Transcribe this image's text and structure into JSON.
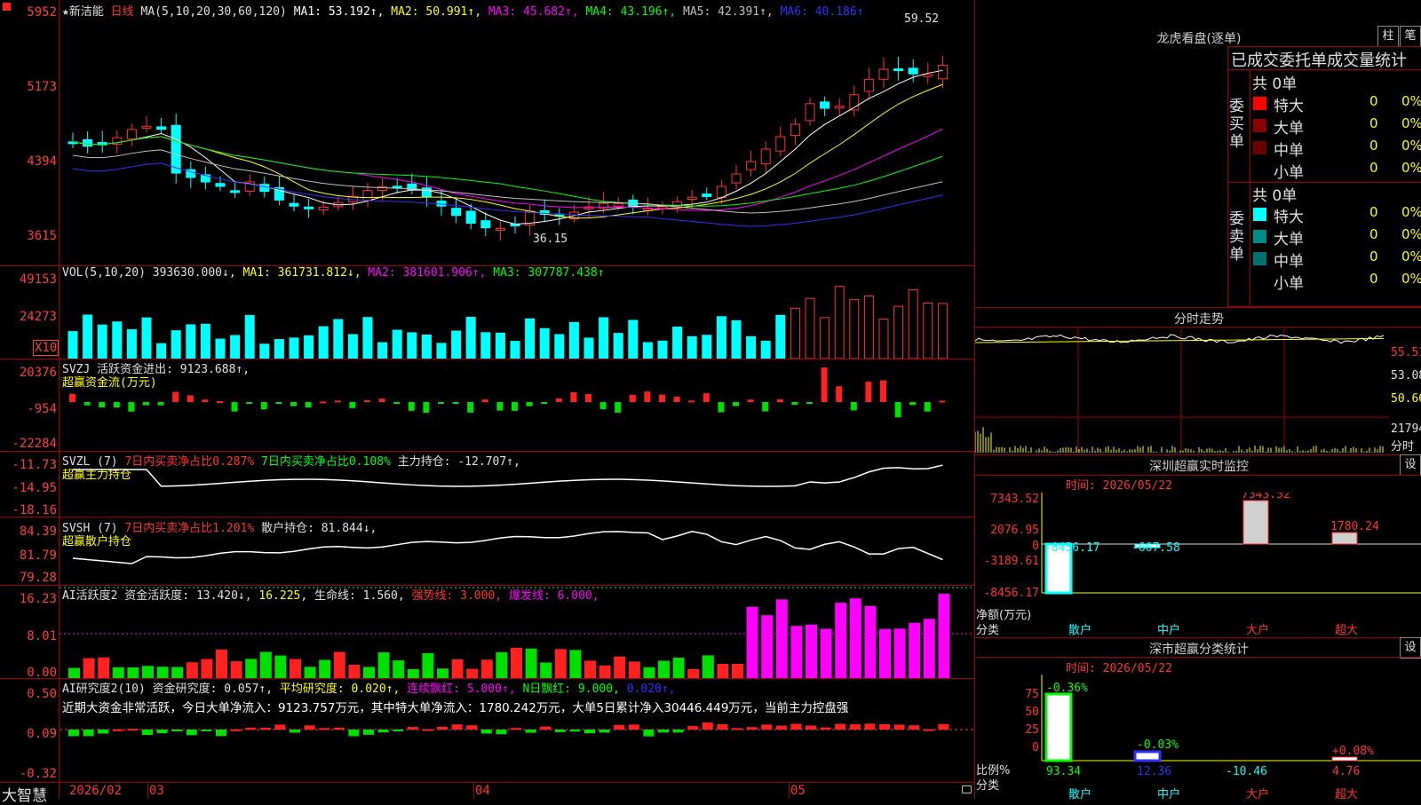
{
  "app": {
    "name": "大智慧"
  },
  "kline": {
    "title": "★新洁能",
    "period": "日线",
    "ma_label": "MA(5,10,20,30,60,120)",
    "ma1": "MA1: 53.192↑,",
    "ma2": "MA2: 50.991↑,",
    "ma3": "MA3: 45.682↑,",
    "ma4": "MA4: 43.196↑,",
    "ma5": "MA5: 42.391↑,",
    "ma6": "MA6: 40.186↑",
    "y_labels": [
      "5952",
      "5173",
      "4394",
      "3615"
    ],
    "high_label": "59.52",
    "low_label": "36.15"
  },
  "vol": {
    "title": "VOL(5,10,20) 393630.000↓,",
    "ma1": "MA1: 361731.812↓,",
    "ma2": "MA2: 381601.906↑,",
    "ma3": "MA3: 307787.438↑",
    "y_labels": [
      "49153",
      "24273"
    ],
    "unit": "X10"
  },
  "svzj": {
    "title": "SVZJ  活跃资金进出: 9123.688↑,",
    "subtitle": "超赢资金流(万元)",
    "y_labels": [
      "20376",
      "-954",
      "-22284"
    ]
  },
  "svzl": {
    "title_a": "SVZL (7)",
    "title_b": "7日内买卖净占比0.287%",
    "title_c": "7日内买卖净占比0.108%",
    "title_d": "主力持仓: -12.707↑,",
    "subtitle": "超赢主力持仓",
    "y_labels": [
      "-11.73",
      "-14.95",
      "-18.16"
    ]
  },
  "svsh": {
    "title_a": "SVSH (7)",
    "title_b": "7日内买卖净占比1.201%",
    "title_c": "散户持仓: 81.844↓,",
    "subtitle": "超赢散户持仓",
    "y_labels": [
      "84.39",
      "81.79",
      "79.28"
    ]
  },
  "ai_act": {
    "t1": "AI活跃度2 资金活跃度: 13.420↓,",
    "t2": "16.225,",
    "t3": "生命线: 1.560,",
    "t4": "强势线: 3.000,",
    "t5": "爆发线: 6.000,",
    "y_labels": [
      "16.23",
      "8.01",
      "0.00"
    ]
  },
  "ai_res": {
    "t1": "AI研究度2(10) 资金研究度: 0.057↑,",
    "t2": "平均研究度: 0.020↑,",
    "t3": "连续飘红: 5.000↑,",
    "t4": "N日飘红: 9.000,",
    "t5": "0.020↑,",
    "commentary": "近期大资金非常活跃，今日大单净流入：9123.757万元，其中特大单净流入：1780.242万元，大单5日累计净入30446.449万元，当前主力控盘强",
    "y_labels": [
      "0.50",
      "0.09",
      "-0.32"
    ]
  },
  "x_axis": {
    "labels": [
      "2026/02",
      "03",
      "04",
      "05"
    ]
  },
  "lhb": {
    "title": "龙虎看盘(逐单)",
    "btn1": "柱",
    "btn2": "笔",
    "tabs": "已成交委托单成交量统计",
    "buy_side": "委买单",
    "sell_side": "委卖单",
    "buy_total": "共 0单",
    "sell_total": "共 0单",
    "buy_rows": [
      {
        "label": "特大",
        "count": "0",
        "pct": "0%",
        "color": "#ff0000"
      },
      {
        "label": "大单",
        "count": "0",
        "pct": "0%",
        "color": "#8b0000"
      },
      {
        "label": "中单",
        "count": "0",
        "pct": "0%",
        "color": "#6b0000"
      },
      {
        "label": "小单",
        "count": "0",
        "pct": "0%",
        "color": ""
      }
    ],
    "sell_rows": [
      {
        "label": "特大",
        "count": "0",
        "pct": "0%",
        "color": "#00ffff"
      },
      {
        "label": "大单",
        "count": "0",
        "pct": "0%",
        "color": "#008b8b"
      },
      {
        "label": "中单",
        "count": "0",
        "pct": "0%",
        "color": "#007070"
      },
      {
        "label": "小单",
        "count": "0",
        "pct": "0%",
        "color": ""
      }
    ]
  },
  "fenshi": {
    "title": "分时走势",
    "y_labels": [
      "55.51",
      "53.08",
      "50.66"
    ],
    "vol_label": "21794",
    "unit": "分时"
  },
  "sz_monitor": {
    "title": "深圳超赢实时监控",
    "btn": "设",
    "time": "时间: 2026/05/22",
    "y_labels": [
      "7343.52",
      "2076.95",
      "0",
      "-3189.61",
      "-8456.17"
    ],
    "bar_labels": [
      "-8456.17",
      "-667.58",
      "7343.52",
      "1780.24"
    ],
    "unit_a": "净额(万元)",
    "unit_b": "分类",
    "cats": [
      "散户",
      "中户",
      "大户",
      "超大"
    ]
  },
  "sz_stats": {
    "title": "深市超赢分类统计",
    "btn": "设",
    "time": "时间: 2026/05/22",
    "y_labels": [
      "75",
      "50",
      "25",
      "0"
    ],
    "top_labels": [
      "-0.36%",
      "-0.03%",
      "",
      "+0.08%"
    ],
    "values": [
      "93.34",
      "12.36",
      "-10.46",
      "4.76"
    ],
    "unit_a": "比例%",
    "unit_b": "分类",
    "cats": [
      "散户",
      "中户",
      "大户",
      "超大"
    ]
  },
  "colors": {
    "up": "#ff3232",
    "down": "#00ffff",
    "grid": "#a00000",
    "ma1": "#ffffff",
    "ma2": "#ffff00",
    "ma3": "#ff00ff",
    "ma4": "#00ff00",
    "ma5": "#c0c0c0",
    "ma6": "#0000ff"
  }
}
